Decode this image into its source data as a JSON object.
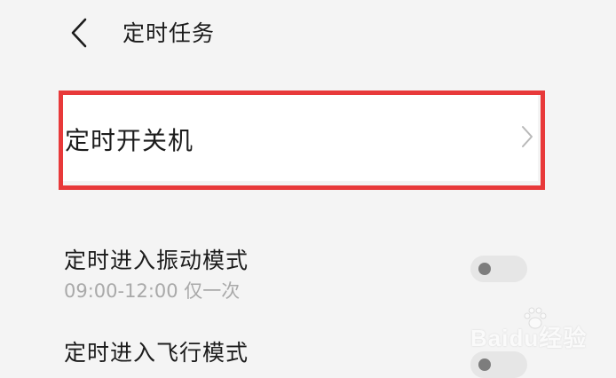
{
  "header": {
    "title": "定时任务"
  },
  "timer_row": {
    "label": "定时开关机"
  },
  "settings": [
    {
      "title": "定时进入振动模式",
      "subtitle": "09:00-12:00 仅一次",
      "toggle_on": false
    },
    {
      "title": "定时进入飞行模式",
      "toggle_on": false
    }
  ],
  "watermark": {
    "text": "Baidu经验"
  },
  "colors": {
    "highlight": "#e8393a",
    "background": "#f4f4f4",
    "subtitle": "#a9a9a9"
  },
  "icons": {
    "back": "chevron-left-icon",
    "row_arrow": "chevron-right-icon",
    "watermark_logo": "paw-icon"
  }
}
